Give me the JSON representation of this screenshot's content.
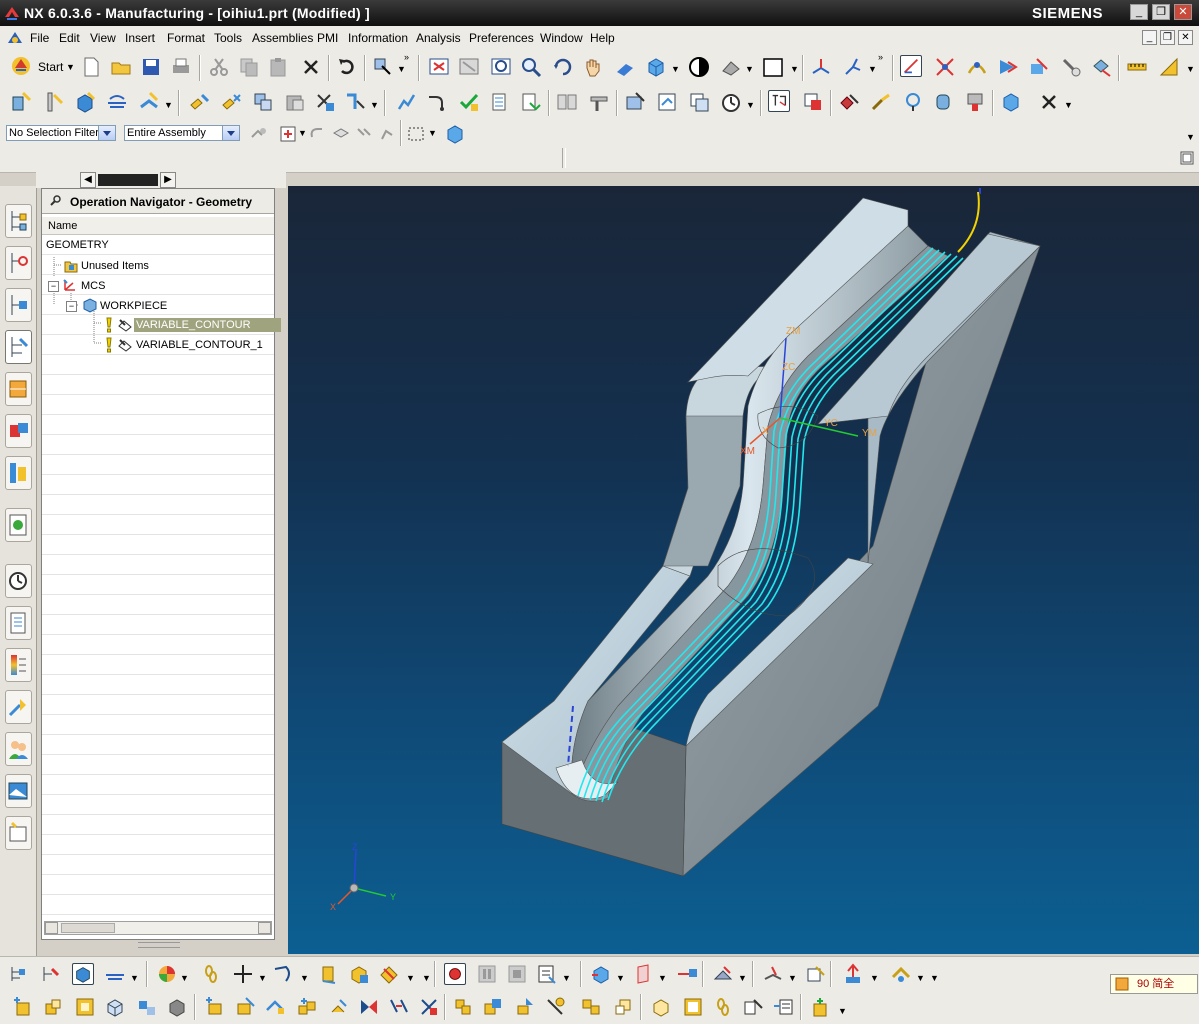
{
  "window": {
    "title": "NX 6.0.3.6 - Manufacturing - [oihiu1.prt (Modified) ]",
    "brand": "SIEMENS",
    "minimize": "_",
    "restore": "❐",
    "close": "✕"
  },
  "menubar": {
    "items": [
      "File",
      "Edit",
      "View",
      "Insert",
      "Format",
      "Tools",
      "Assemblies",
      "PMI",
      "Information",
      "Analysis",
      "Preferences",
      "Window",
      "Help"
    ]
  },
  "toolbar": {
    "start_label": "Start"
  },
  "selection": {
    "filter": "No Selection Filter",
    "scope": "Entire Assembly"
  },
  "navigator": {
    "title": "Operation Navigator - Geometry",
    "column": "Name",
    "tree": {
      "root": "GEOMETRY",
      "unused": "Unused Items",
      "mcs": "MCS",
      "workpiece": "WORKPIECE",
      "op1": "VARIABLE_CONTOUR",
      "op2": "VARIABLE_CONTOUR_1"
    }
  },
  "viewport": {
    "labels": {
      "zm": "ZM",
      "zc": "ZC",
      "yc": "YC",
      "ym": "YM",
      "xm": "XM",
      "xc": "X",
      "triad_z": "Z",
      "triad_y": "Y",
      "triad_x": "X"
    }
  },
  "statusbar": {
    "ime": "90 简全"
  },
  "colors": {
    "toolpath": "#22e8ee",
    "part_top": "#b9cdd9",
    "part_side": "#7f8c92",
    "selected_row": "#a0a47e"
  }
}
